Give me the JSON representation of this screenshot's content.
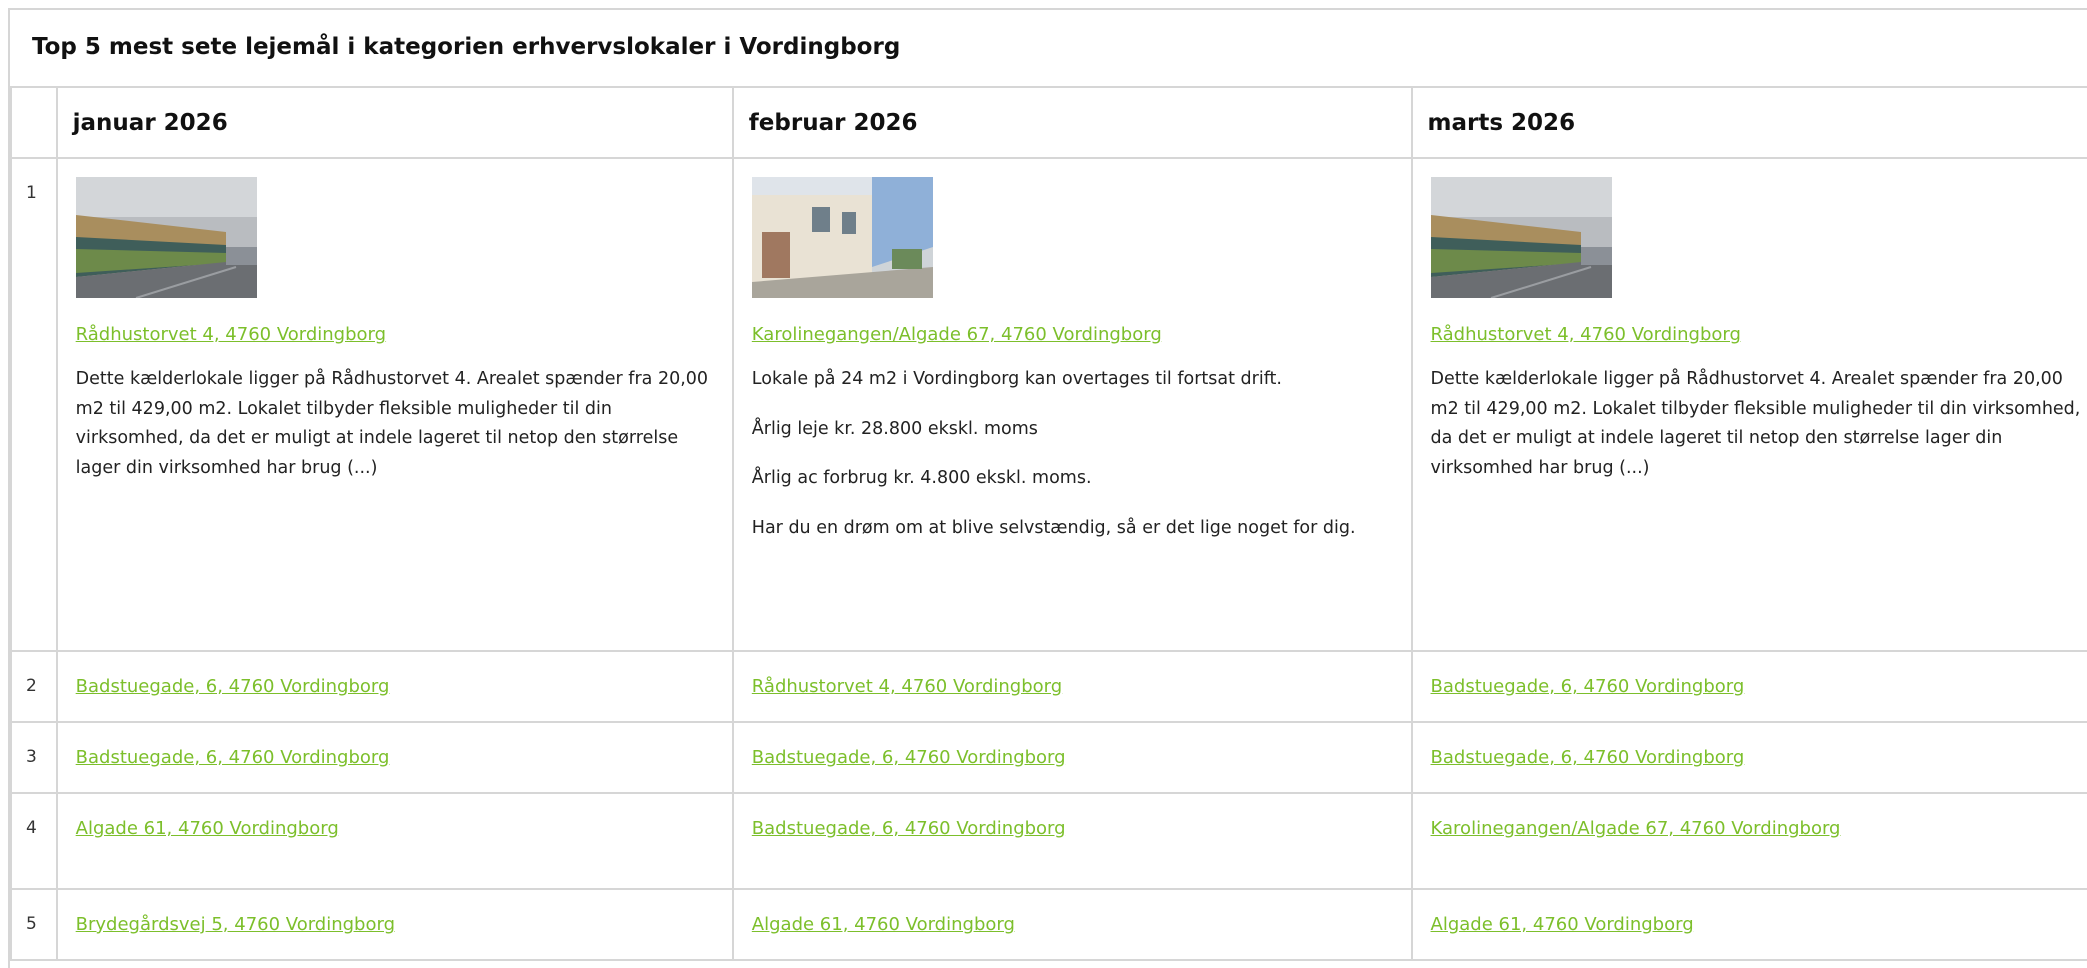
{
  "title": "Top 5 mest sete lejemål i kategorien erhvervslokaler i Vordingborg",
  "colors": {
    "link": "#7cbf2b",
    "border": "#d6d6d6"
  },
  "months": [
    {
      "label": "januar 2026"
    },
    {
      "label": "februar 2026"
    },
    {
      "label": "marts 2026"
    }
  ],
  "ranks": [
    "1",
    "2",
    "3",
    "4",
    "5"
  ],
  "top": [
    {
      "address": "Rådhustorvet 4, 4760 Vordingborg",
      "image": "street-building-photo",
      "paragraphs": [
        "Dette kælderlokale ligger på Rådhustorvet 4. Arealet spænder fra 20,00 m2 til 429,00 m2. Lokalet tilbyder fleksible muligheder til din virksomhed, da det er muligt at indele lageret til netop den størrelse lager din virksomhed har brug (...)"
      ]
    },
    {
      "address": "Karolinegangen/Algade 67, 4760 Vordingborg",
      "image": "white-building-photo",
      "paragraphs": [
        "Lokale på 24 m2 i Vordingborg kan overtages til fortsat drift.",
        "Årlig leje kr. 28.800 ekskl. moms",
        "Årlig ac forbrug kr. 4.800 ekskl. moms.",
        "Har du en drøm om at blive selvstændig, så er det lige noget for dig."
      ]
    },
    {
      "address": "Rådhustorvet 4, 4760 Vordingborg",
      "image": "street-building-photo",
      "paragraphs": [
        "Dette kælderlokale ligger på Rådhustorvet 4. Arealet spænder fra 20,00 m2 til 429,00 m2. Lokalet tilbyder fleksible muligheder til din virksomhed, da det er muligt at indele lageret til netop den størrelse lager din virksomhed har brug (...)"
      ]
    }
  ],
  "rows": [
    [
      "Badstuegade, 6, 4760 Vordingborg",
      "Rådhustorvet 4, 4760 Vordingborg",
      "Badstuegade, 6, 4760 Vordingborg"
    ],
    [
      "Badstuegade, 6, 4760 Vordingborg",
      "Badstuegade, 6, 4760 Vordingborg",
      "Badstuegade, 6, 4760 Vordingborg"
    ],
    [
      "Algade 61, 4760 Vordingborg",
      "Badstuegade, 6, 4760 Vordingborg",
      "Karolinegangen/Algade 67, 4760 Vordingborg"
    ],
    [
      "Brydegårdsvej 5, 4760 Vordingborg",
      "Algade 61, 4760 Vordingborg",
      "Algade 61, 4760 Vordingborg"
    ]
  ]
}
